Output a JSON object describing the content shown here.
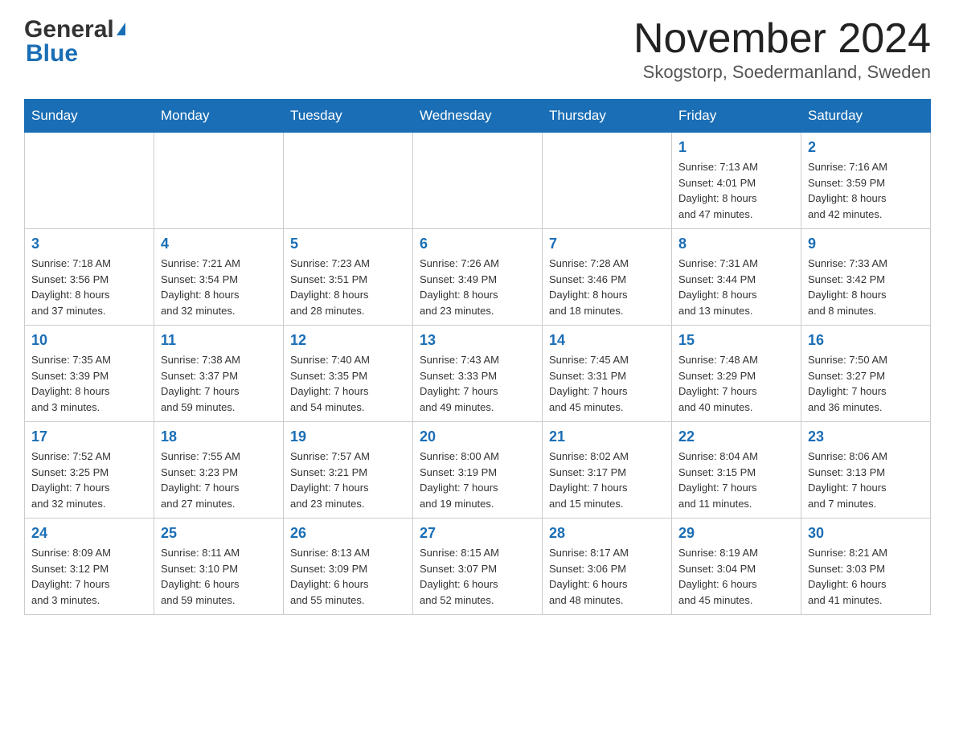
{
  "header": {
    "logo_general": "General",
    "logo_blue": "Blue",
    "title": "November 2024",
    "location": "Skogstorp, Soedermanland, Sweden"
  },
  "days_of_week": [
    "Sunday",
    "Monday",
    "Tuesday",
    "Wednesday",
    "Thursday",
    "Friday",
    "Saturday"
  ],
  "weeks": [
    {
      "days": [
        {
          "number": "",
          "info": ""
        },
        {
          "number": "",
          "info": ""
        },
        {
          "number": "",
          "info": ""
        },
        {
          "number": "",
          "info": ""
        },
        {
          "number": "",
          "info": ""
        },
        {
          "number": "1",
          "info": "Sunrise: 7:13 AM\nSunset: 4:01 PM\nDaylight: 8 hours\nand 47 minutes."
        },
        {
          "number": "2",
          "info": "Sunrise: 7:16 AM\nSunset: 3:59 PM\nDaylight: 8 hours\nand 42 minutes."
        }
      ]
    },
    {
      "days": [
        {
          "number": "3",
          "info": "Sunrise: 7:18 AM\nSunset: 3:56 PM\nDaylight: 8 hours\nand 37 minutes."
        },
        {
          "number": "4",
          "info": "Sunrise: 7:21 AM\nSunset: 3:54 PM\nDaylight: 8 hours\nand 32 minutes."
        },
        {
          "number": "5",
          "info": "Sunrise: 7:23 AM\nSunset: 3:51 PM\nDaylight: 8 hours\nand 28 minutes."
        },
        {
          "number": "6",
          "info": "Sunrise: 7:26 AM\nSunset: 3:49 PM\nDaylight: 8 hours\nand 23 minutes."
        },
        {
          "number": "7",
          "info": "Sunrise: 7:28 AM\nSunset: 3:46 PM\nDaylight: 8 hours\nand 18 minutes."
        },
        {
          "number": "8",
          "info": "Sunrise: 7:31 AM\nSunset: 3:44 PM\nDaylight: 8 hours\nand 13 minutes."
        },
        {
          "number": "9",
          "info": "Sunrise: 7:33 AM\nSunset: 3:42 PM\nDaylight: 8 hours\nand 8 minutes."
        }
      ]
    },
    {
      "days": [
        {
          "number": "10",
          "info": "Sunrise: 7:35 AM\nSunset: 3:39 PM\nDaylight: 8 hours\nand 3 minutes."
        },
        {
          "number": "11",
          "info": "Sunrise: 7:38 AM\nSunset: 3:37 PM\nDaylight: 7 hours\nand 59 minutes."
        },
        {
          "number": "12",
          "info": "Sunrise: 7:40 AM\nSunset: 3:35 PM\nDaylight: 7 hours\nand 54 minutes."
        },
        {
          "number": "13",
          "info": "Sunrise: 7:43 AM\nSunset: 3:33 PM\nDaylight: 7 hours\nand 49 minutes."
        },
        {
          "number": "14",
          "info": "Sunrise: 7:45 AM\nSunset: 3:31 PM\nDaylight: 7 hours\nand 45 minutes."
        },
        {
          "number": "15",
          "info": "Sunrise: 7:48 AM\nSunset: 3:29 PM\nDaylight: 7 hours\nand 40 minutes."
        },
        {
          "number": "16",
          "info": "Sunrise: 7:50 AM\nSunset: 3:27 PM\nDaylight: 7 hours\nand 36 minutes."
        }
      ]
    },
    {
      "days": [
        {
          "number": "17",
          "info": "Sunrise: 7:52 AM\nSunset: 3:25 PM\nDaylight: 7 hours\nand 32 minutes."
        },
        {
          "number": "18",
          "info": "Sunrise: 7:55 AM\nSunset: 3:23 PM\nDaylight: 7 hours\nand 27 minutes."
        },
        {
          "number": "19",
          "info": "Sunrise: 7:57 AM\nSunset: 3:21 PM\nDaylight: 7 hours\nand 23 minutes."
        },
        {
          "number": "20",
          "info": "Sunrise: 8:00 AM\nSunset: 3:19 PM\nDaylight: 7 hours\nand 19 minutes."
        },
        {
          "number": "21",
          "info": "Sunrise: 8:02 AM\nSunset: 3:17 PM\nDaylight: 7 hours\nand 15 minutes."
        },
        {
          "number": "22",
          "info": "Sunrise: 8:04 AM\nSunset: 3:15 PM\nDaylight: 7 hours\nand 11 minutes."
        },
        {
          "number": "23",
          "info": "Sunrise: 8:06 AM\nSunset: 3:13 PM\nDaylight: 7 hours\nand 7 minutes."
        }
      ]
    },
    {
      "days": [
        {
          "number": "24",
          "info": "Sunrise: 8:09 AM\nSunset: 3:12 PM\nDaylight: 7 hours\nand 3 minutes."
        },
        {
          "number": "25",
          "info": "Sunrise: 8:11 AM\nSunset: 3:10 PM\nDaylight: 6 hours\nand 59 minutes."
        },
        {
          "number": "26",
          "info": "Sunrise: 8:13 AM\nSunset: 3:09 PM\nDaylight: 6 hours\nand 55 minutes."
        },
        {
          "number": "27",
          "info": "Sunrise: 8:15 AM\nSunset: 3:07 PM\nDaylight: 6 hours\nand 52 minutes."
        },
        {
          "number": "28",
          "info": "Sunrise: 8:17 AM\nSunset: 3:06 PM\nDaylight: 6 hours\nand 48 minutes."
        },
        {
          "number": "29",
          "info": "Sunrise: 8:19 AM\nSunset: 3:04 PM\nDaylight: 6 hours\nand 45 minutes."
        },
        {
          "number": "30",
          "info": "Sunrise: 8:21 AM\nSunset: 3:03 PM\nDaylight: 6 hours\nand 41 minutes."
        }
      ]
    }
  ]
}
